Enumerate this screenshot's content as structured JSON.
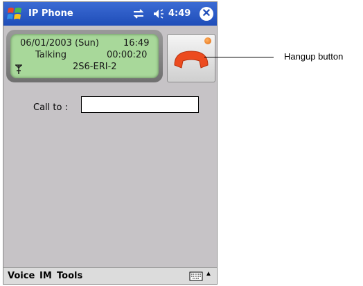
{
  "titlebar": {
    "app_title": "IP Phone",
    "clock": "4:49",
    "close_glyph": "✕",
    "icons": [
      "windows-start-icon",
      "connectivity-icon",
      "volume-icon",
      "close-icon"
    ]
  },
  "display": {
    "date": "06/01/2003 (Sun)",
    "time": "16:49",
    "status": "Talking",
    "duration": "00:00:20",
    "line": "2S6-ERI-2",
    "icons": [
      "antenna-icon"
    ]
  },
  "hangup": {
    "icons": [
      "handset-icon",
      "status-led-icon"
    ],
    "colors": {
      "handset": "#ec4b1f",
      "led": "#e06a10"
    }
  },
  "callto": {
    "label": "Call to :",
    "value": ""
  },
  "bottombar": {
    "menu": [
      "Voice",
      "IM",
      "Tools"
    ],
    "icons": [
      "keyboard-icon",
      "sip-arrow-icon"
    ],
    "sip_arrow": "▲"
  },
  "annotation": {
    "label": "Hangup button"
  },
  "colors": {
    "titlebar": "#2a5bc8",
    "display_lcd": "#a8d89a",
    "background": "#c6c3c6"
  }
}
